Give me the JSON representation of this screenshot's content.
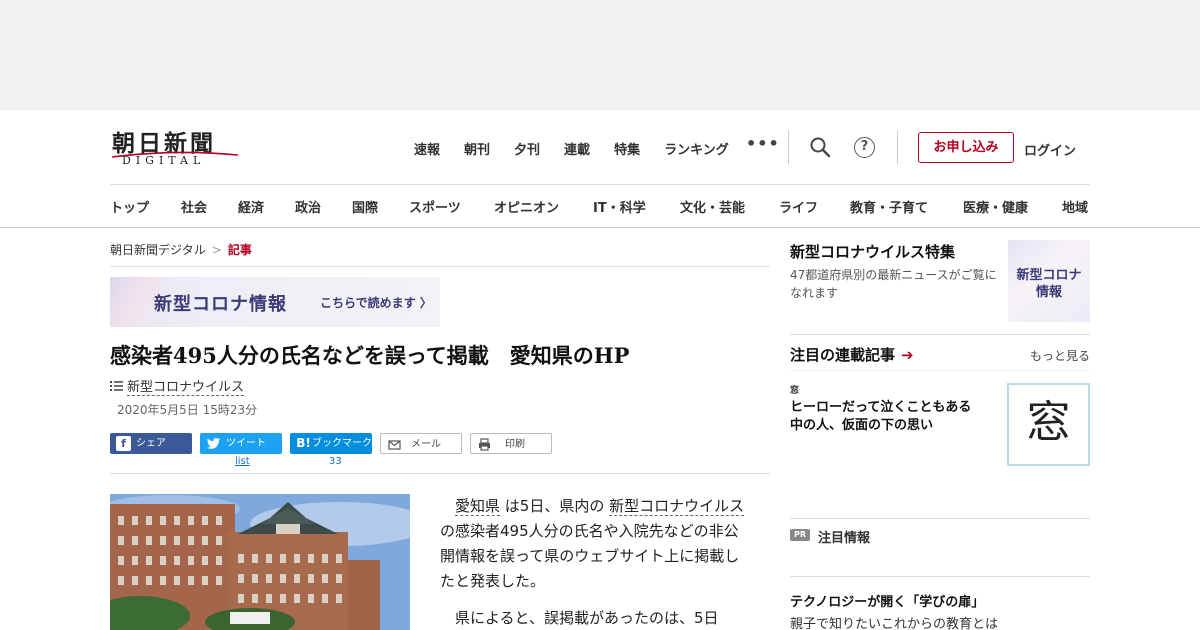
{
  "header": {
    "logo_main": "朝日新聞",
    "logo_sub": "DIGITAL",
    "top_nav": [
      "速報",
      "朝刊",
      "夕刊",
      "連載",
      "特集",
      "ランキング"
    ],
    "more_label": "•••",
    "subscribe_label": "お申し込み",
    "login_label": "ログイン",
    "help_label": "?"
  },
  "category_nav": [
    "トップ",
    "社会",
    "経済",
    "政治",
    "国際",
    "スポーツ",
    "オピニオン",
    "IT・科学",
    "文化・芸能",
    "ライフ",
    "教育・子育て",
    "医療・健康",
    "地域"
  ],
  "breadcrumb": {
    "home": "朝日新聞デジタル",
    "separator": ">",
    "current": "記事"
  },
  "covid_banner": {
    "title": "新型コロナ情報",
    "link": "こちらで読めます 〉"
  },
  "article": {
    "title": "感染者495人分の氏名などを誤って掲載　愛知県のHP",
    "topic": "新型コロナウイルス",
    "date": "2020年5月5日 15時23分",
    "paragraph1_parts": [
      "愛知県",
      " は5日、県内の ",
      "新型コロナウイルス",
      " の感染者495人分の氏名や入院先などの非公開情報を誤って県のウェブサイト上に掲載したと発表した。"
    ],
    "paragraph2": "県によると、誤掲載があったのは、5日"
  },
  "share": {
    "facebook": "シェア",
    "twitter": "ツイート",
    "twitter_count": "list",
    "hatena": "ブックマーク",
    "hatena_icon": "B!",
    "hatena_count": "33",
    "mail": "メール",
    "print": "印刷"
  },
  "sidebar": {
    "covid_title": "新型コロナウイルス特集",
    "covid_desc": "47都道府県別の最新ニュースがご覧になれます",
    "covid_thumb_line1": "新型コロナ",
    "covid_thumb_line2": "情報",
    "series_title": "注目の連載記事",
    "series_arrow": "➔",
    "more_label": "もっと見る",
    "mado_label": "窓",
    "mado_title": "ヒーローだって泣くこともある　中の人、仮面の下の思い",
    "mado_thumb_char": "窓",
    "pr_badge": "PR",
    "pr_label": "注目情報",
    "pr_title": "テクノロジーが開く「学びの扉」",
    "pr_sub": "親子で知りたいこれからの教育とは"
  },
  "colors": {
    "accent": "#b4001e",
    "facebook": "#3b5998",
    "twitter": "#1da1f2",
    "hatena": "#008fde",
    "covid_purple": "#3d3a78"
  },
  "icons": {
    "search": "search-icon",
    "help": "help-icon",
    "list": "list-icon",
    "mail": "mail-icon",
    "print": "printer-icon"
  }
}
